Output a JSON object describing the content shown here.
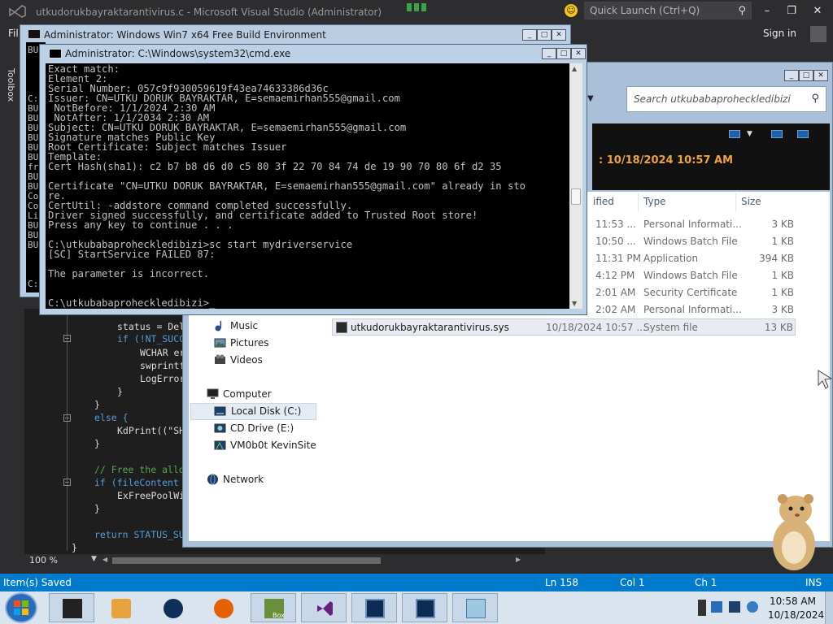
{
  "vs": {
    "title": "utkudorukbayraktarantivirus.c - Microsoft Visual Studio (Administrator)",
    "quick_launch": "Quick Launch (Ctrl+Q)",
    "menu_file": "Fil",
    "sign_in": "Sign in",
    "toolbox": "Toolbox",
    "zoom": "100 %",
    "status": {
      "message": "Item(s) Saved",
      "ln": "Ln 158",
      "col": "Col 1",
      "ch": "Ch 1",
      "mode": "INS"
    },
    "code": [
      "status = Del",
      "if (!NT_SUCC",
      "WCHAR er",
      "swprintf",
      "LogError",
      "}",
      "}",
      "else {",
      "KdPrint((\"SH",
      "}",
      "// Free the allo",
      "if (fileContent",
      "ExFreePoolWi",
      "}",
      "return STATUS_SU",
      "}"
    ]
  },
  "buildenv": {
    "title": "Administrator:  Windows Win7 x64 Free Build Environment",
    "left_text": [
      "BU",
      "C:",
      "BU",
      "BU",
      "BU",
      "BU",
      "BU",
      "BU",
      "fr",
      "BU",
      "BU",
      "Co",
      "Co",
      "Li",
      "BU",
      "BU",
      "BU",
      "C:"
    ]
  },
  "cmd": {
    "title": "Administrator: C:\\Windows\\system32\\cmd.exe",
    "lines": [
      "Exact match:",
      "Element 2:",
      "Serial Number: 057c9f930059619f43ea74633386d36c",
      "Issuer: CN=UTKU DORUK BAYRAKTAR, E=semaemirhan555@gmail.com",
      " NotBefore: 1/1/2024 2:30 AM",
      " NotAfter: 1/1/2034 2:30 AM",
      "Subject: CN=UTKU DORUK BAYRAKTAR, E=semaemirhan555@gmail.com",
      "Signature matches Public Key",
      "Root Certificate: Subject matches Issuer",
      "Template:",
      "Cert Hash(sha1): c2 b7 b8 d6 d0 c5 80 3f 22 70 84 74 de 19 90 70 80 6f d2 35",
      "",
      "Certificate \"CN=UTKU DORUK BAYRAKTAR, E=semaemirhan555@gmail.com\" already in sto",
      "re.",
      "CertUtil: -addstore command completed successfully.",
      "Driver signed successfully, and certificate added to Trusted Root store!",
      "Press any key to continue . . .",
      "",
      "C:\\utkubabaproheckledibizi>sc start mydriverservice",
      "[SC] StartService FAILED 87:",
      "",
      "The parameter is incorrect.",
      "",
      "",
      "C:\\utkubabaproheckledibizi>_"
    ]
  },
  "explorer": {
    "search_placeholder": "Search utkubabaproheckledibizi",
    "banner_date": ": 10/18/2024 10:57 AM",
    "columns": {
      "modified": "ified",
      "type": "Type",
      "size": "Size"
    },
    "rows": [
      {
        "name": "",
        "modified": "11:53 ...",
        "type": "Personal Informati...",
        "size": "3 KB"
      },
      {
        "name": "",
        "modified": "10:50 ...",
        "type": "Windows Batch File",
        "size": "1 KB"
      },
      {
        "name": "",
        "modified": "11:31 PM",
        "type": "Application",
        "size": "394 KB"
      },
      {
        "name": "",
        "modified": "4:12 PM",
        "type": "Windows Batch File",
        "size": "1 KB"
      },
      {
        "name": "",
        "modified": "2:01 AM",
        "type": "Security Certificate",
        "size": "1 KB"
      },
      {
        "name": "",
        "modified": "2:02 AM",
        "type": "Personal Informati...",
        "size": "3 KB"
      },
      {
        "name": "utkudorukbayraktarantivirus.sys",
        "modified": "10/18/2024 10:57 ...",
        "type": "System file",
        "size": "13 KB"
      }
    ],
    "nav": {
      "music": "Music",
      "pictures": "Pictures",
      "videos": "Videos",
      "computer": "Computer",
      "local_disk": "Local Disk (C:)",
      "cd_drive": "CD Drive (E:)",
      "vm": "VM0b0t KevinSite",
      "network": "Network"
    }
  },
  "taskbar": {
    "time": "10:58 AM",
    "date": "10/18/2024",
    "box_label": "Box"
  },
  "colors": {
    "vs_status": "#007acc",
    "banner_date": "#f0a23a",
    "console_text": "#c0c0c0"
  }
}
